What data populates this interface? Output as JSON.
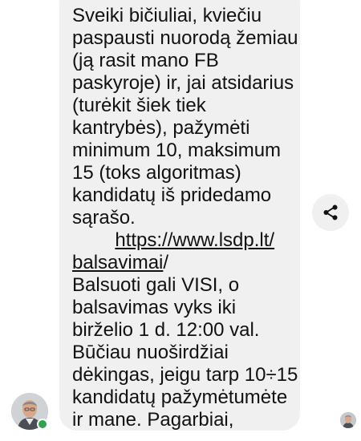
{
  "message": {
    "lines": [
      "Sveiki bičiuliai, kviečiu",
      "paspausti nuorodą žemiau",
      "(ją rasit mano FB",
      "paskyroje) ir, jai atsidarius",
      "(turėkit šiek tiek",
      "kantrybės), pažymėti",
      "minimum 10, maksimum",
      "15 (toks algoritmas)",
      "kandidatų iš pridedamo",
      "sąrašo."
    ],
    "link_indent": "        ",
    "link_part1": "https://www.lsdp.lt/",
    "link_part2": "balsavimai",
    "link_suffix": "/",
    "lines_after": [
      "Balsuoti gali VISI, o",
      "balsavimas vyks iki",
      "birželio 1 d. 12:00 val.",
      "Būčiau nuoširdžiai",
      "dėkingas, jeigu tarp 10÷15",
      "kandidatų pažymėtumėte",
      "ir mane. Pagarbiai,"
    ]
  },
  "icons": {
    "share": "share-icon",
    "avatar": "sender-avatar",
    "seen": "seen-receipt-avatar"
  },
  "colors": {
    "bubble": "#f0f0f0",
    "online": "#31a24c",
    "text": "#111111"
  }
}
